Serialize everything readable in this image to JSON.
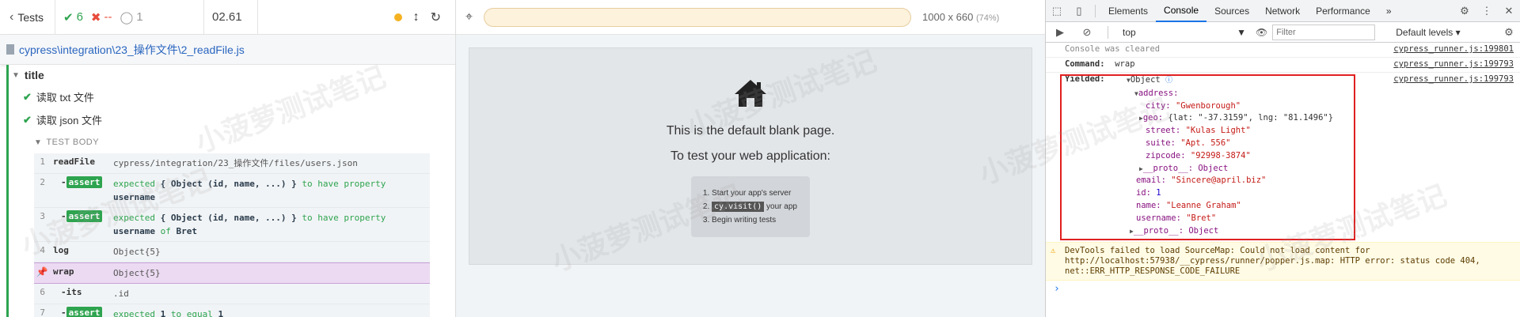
{
  "reporter": {
    "tests_label": "Tests",
    "passed": "6",
    "failed": "--",
    "pending": "1",
    "duration": "02.61",
    "spec_path": "cypress\\integration\\23_操作文件\\2_readFile.js",
    "suite_title": "title",
    "tests": [
      "读取 txt 文件",
      "读取 json 文件"
    ],
    "test_body_label": "TEST BODY",
    "commands": [
      {
        "num": "1",
        "name": "readFile",
        "msg": "cypress/integration/23_操作文件/files/users.json"
      },
      {
        "num": "2",
        "name": "assert",
        "msg_pre": "expected",
        "msg_obj": "{ Object (id, name, ...) }",
        "msg_mid": "to have property",
        "msg_val": "username"
      },
      {
        "num": "3",
        "name": "assert",
        "msg_pre": "expected",
        "msg_obj": "{ Object (id, name, ...) }",
        "msg_mid": "to have property",
        "msg_val": "username",
        "msg_of": "of",
        "msg_val2": "Bret"
      },
      {
        "num": "4",
        "name": "log",
        "msg": "Object{5}"
      },
      {
        "num": "",
        "name": "wrap",
        "msg": "Object{5}"
      },
      {
        "num": "6",
        "name": "its",
        "msg": ".id"
      },
      {
        "num": "7",
        "name": "assert",
        "msg_pre": "expected",
        "msg_val": "1",
        "msg_mid": "to equal",
        "msg_val2": "1"
      }
    ]
  },
  "aut": {
    "viewport": "1000 x 660",
    "zoom": "(74%)",
    "blank_title": "This is the default blank page.",
    "blank_sub": "To test your web application:",
    "steps": [
      "Start your app's server",
      "your app",
      "Begin writing tests"
    ],
    "step2_code": "cy.visit()"
  },
  "devtools": {
    "tabs": [
      "Elements",
      "Console",
      "Sources",
      "Network",
      "Performance"
    ],
    "active_tab": "Console",
    "more_tabs": "»",
    "context": "top",
    "filter_placeholder": "Filter",
    "levels": "Default levels ▾",
    "lines": {
      "cleared": "Console was cleared",
      "cleared_src": "cypress_runner.js:199801",
      "command_label": "Command:",
      "command_val": "wrap",
      "command_src": "cypress_runner.js:199793",
      "yielded_label": "Yielded:",
      "yielded_src": "cypress_runner.js:199793"
    },
    "tree": {
      "root": "Object",
      "address": "address:",
      "city_k": "city:",
      "city_v": "\"Gwenborough\"",
      "geo_k": "geo:",
      "geo_v": "{lat: \"-37.3159\", lng: \"81.1496\"}",
      "street_k": "street:",
      "street_v": "\"Kulas Light\"",
      "suite_k": "suite:",
      "suite_v": "\"Apt. 556\"",
      "zip_k": "zipcode:",
      "zip_v": "\"92998-3874\"",
      "proto1": "__proto__: Object",
      "email_k": "email:",
      "email_v": "\"Sincere@april.biz\"",
      "id_k": "id:",
      "id_v": "1",
      "name_k": "name:",
      "name_v": "\"Leanne Graham\"",
      "user_k": "username:",
      "user_v": "\"Bret\"",
      "proto2": "__proto__: Object"
    },
    "warning_pre": "DevTools failed to load SourceMap: Could not load content for ",
    "warning_link": "http://localhost:57938/__cypress/runner/popper.js.map",
    "warning_post": ": HTTP error: status code 404, net::ERR_HTTP_RESPONSE_CODE_FAILURE",
    "prompt": "›"
  },
  "watermark": "小菠萝测试笔记"
}
